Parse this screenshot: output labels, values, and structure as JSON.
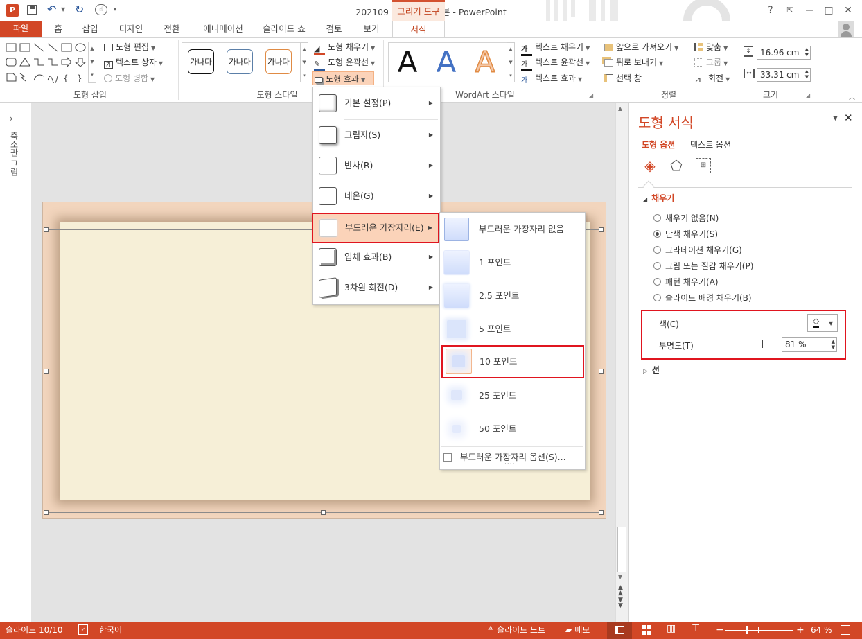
{
  "window": {
    "title": "202109 포스팅용 완성본 - PowerPoint",
    "context_tab": "그리기 도구",
    "buttons": {
      "help": "?",
      "minimize": "—",
      "restore": "□",
      "close": "✕"
    }
  },
  "tabs": [
    "파일",
    "홈",
    "삽입",
    "디자인",
    "전환",
    "애니메이션",
    "슬라이드 쇼",
    "검토",
    "보기",
    "서식"
  ],
  "ribbon": {
    "insert_shapes": {
      "edit_shape": "도형 편집",
      "text_box": "텍스트 상자",
      "merge_shapes": "도형 병합",
      "label": "도형 삽입"
    },
    "shape_styles": {
      "preset_text": "가나다",
      "fill": "도형 채우기",
      "outline": "도형 윤곽선",
      "effects": "도형 효과",
      "label": "도형 스타일"
    },
    "wordart": {
      "letter": "A",
      "text_fill": "텍스트 채우기",
      "text_outline": "텍스트 윤곽선",
      "text_effects": "텍스트 효과",
      "label": "WordArt 스타일"
    },
    "arrange": {
      "bring_forward": "앞으로 가져오기",
      "send_backward": "뒤로 보내기",
      "selection_pane": "선택 창",
      "align": "맞춤",
      "group": "그룹",
      "rotate": "회전",
      "label": "정렬"
    },
    "size": {
      "height": "16.96 cm",
      "width": "33.31 cm",
      "label": "크기"
    }
  },
  "left_pane": {
    "label": "축소판 그림"
  },
  "effects_menu": {
    "items": [
      {
        "label": "기본 설정(P)"
      },
      {
        "label": "그림자(S)"
      },
      {
        "label": "반사(R)"
      },
      {
        "label": "네온(G)"
      },
      {
        "label": "부드러운 가장자리(E)"
      },
      {
        "label": "입체 효과(B)"
      },
      {
        "label": "3차원 회전(D)"
      }
    ]
  },
  "soft_edges_menu": {
    "items": [
      {
        "label": "부드러운 가장자리 없음"
      },
      {
        "label": "1 포인트"
      },
      {
        "label": "2.5 포인트"
      },
      {
        "label": "5 포인트"
      },
      {
        "label": "10 포인트"
      },
      {
        "label": "25 포인트"
      },
      {
        "label": "50 포인트"
      }
    ],
    "options_label": "부드러운 가장자리 옵션(S)...",
    "grip": "····"
  },
  "format_pane": {
    "title": "도형 서식",
    "tab_shape": "도형 옵션",
    "tab_text": "텍스트 옵션",
    "fill_section": "채우기",
    "fill_options": [
      {
        "label": "채우기 없음(N)",
        "selected": false
      },
      {
        "label": "단색 채우기(S)",
        "selected": true
      },
      {
        "label": "그라데이션 채우기(G)",
        "selected": false
      },
      {
        "label": "그림 또는 질감 채우기(P)",
        "selected": false
      },
      {
        "label": "패턴 채우기(A)",
        "selected": false
      },
      {
        "label": "슬라이드 배경 채우기(B)",
        "selected": false
      }
    ],
    "color_label": "색(C)",
    "transparency_label": "투명도(T)",
    "transparency_value": "81 %",
    "transparency_fraction": 0.81,
    "line_section": "선"
  },
  "status": {
    "slide": "슬라이드 10/10",
    "language": "한국어",
    "notes": "슬라이드 노트",
    "comments": "메모",
    "zoom": "64 %",
    "minus": "−",
    "plus": "+"
  },
  "colors": {
    "accent": "#d24726",
    "highlight_red": "#e0151f",
    "slide_bg": "#f2d5bd",
    "shape_fill": "#f6efd7"
  }
}
